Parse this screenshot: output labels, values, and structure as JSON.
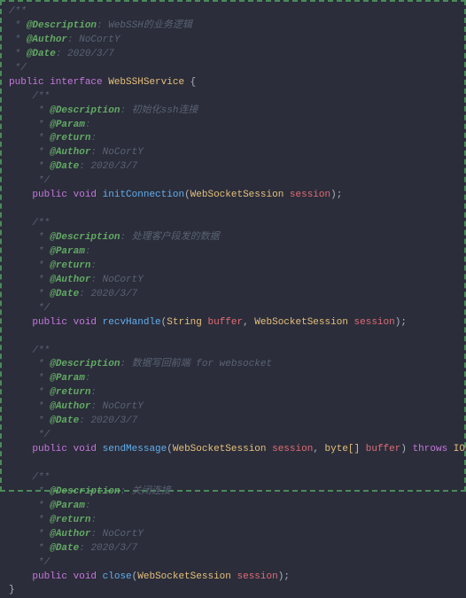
{
  "classDoc": {
    "description": "WebSSH的业务逻辑",
    "author": "NoCortY",
    "date": "2020/3/7"
  },
  "classDecl": {
    "modifiers": "public interface",
    "name": "WebSSHService"
  },
  "methods": [
    {
      "doc": {
        "description": "初始化ssh连接",
        "param": "",
        "return": "",
        "author": "NoCortY",
        "date": "2020/3/7"
      },
      "modifiers": "public void",
      "name": "initConnection",
      "params": [
        {
          "type": "WebSocketSession",
          "name": "session"
        }
      ],
      "throws": null
    },
    {
      "doc": {
        "description": "处理客户段发的数据",
        "param": "",
        "return": "",
        "author": "NoCortY",
        "date": "2020/3/7"
      },
      "modifiers": "public void",
      "name": "recvHandle",
      "params": [
        {
          "type": "String",
          "name": "buffer"
        },
        {
          "type": "WebSocketSession",
          "name": "session"
        }
      ],
      "throws": null
    },
    {
      "doc": {
        "description": "数据写回前端 for websocket",
        "param": "",
        "return": "",
        "author": "NoCortY",
        "date": "2020/3/7"
      },
      "modifiers": "public void",
      "name": "sendMessage",
      "params": [
        {
          "type": "WebSocketSession",
          "name": "session"
        },
        {
          "type": "byte[]",
          "name": "buffer"
        }
      ],
      "throws": "IOException"
    },
    {
      "doc": {
        "description": "关闭连接",
        "param": "",
        "return": "",
        "author": "NoCortY",
        "date": "2020/3/7"
      },
      "modifiers": "public void",
      "name": "close",
      "params": [
        {
          "type": "WebSocketSession",
          "name": "session"
        }
      ],
      "throws": null
    }
  ],
  "tags": {
    "description": "@Description",
    "author": "@Author",
    "date": "@Date",
    "param": "@Param",
    "return": "@return"
  },
  "kw": {
    "throws": "throws"
  }
}
